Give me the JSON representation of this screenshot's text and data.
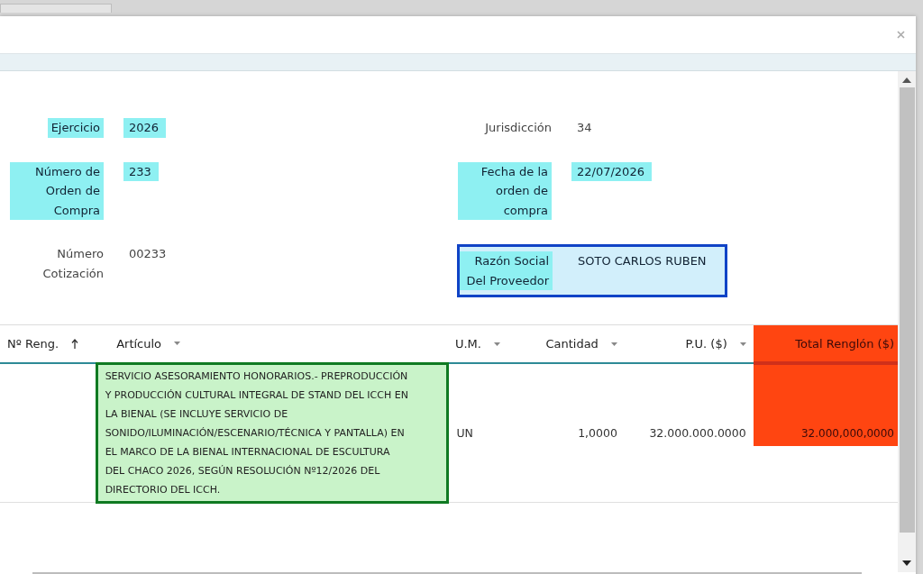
{
  "fields": [
    {
      "label": "Ejercicio",
      "value": "2026",
      "highlighted": true,
      "framed": false
    },
    {
      "label": "Jurisdicción",
      "value": "34",
      "highlighted": false,
      "framed": false
    },
    {
      "label": "Número de Orden de Compra",
      "value": "233",
      "highlighted": true,
      "framed": false
    },
    {
      "label": "Fecha de la orden de compra",
      "value": "22/07/2026",
      "highlighted": true,
      "framed": false
    },
    {
      "label": "Número Cotización",
      "value": "00233",
      "highlighted": false,
      "framed": false
    },
    {
      "label": "Razón Social Del Proveedor",
      "value": "SOTO CARLOS RUBEN",
      "highlighted": true,
      "framed": true
    }
  ],
  "table": {
    "columns": [
      {
        "label": "Nº Reng.",
        "sorted": true,
        "menu": false,
        "highlighted": false
      },
      {
        "label": "Artículo",
        "sorted": false,
        "menu": true,
        "highlighted": false
      },
      {
        "label": "U.M.",
        "sorted": false,
        "menu": true,
        "highlighted": false
      },
      {
        "label": "Cantidad",
        "sorted": false,
        "menu": true,
        "highlighted": false
      },
      {
        "label": "P.U. ($)",
        "sorted": false,
        "menu": true,
        "highlighted": false
      },
      {
        "label": "Total Renglón ($)",
        "sorted": false,
        "menu": false,
        "highlighted": true
      }
    ],
    "rows": [
      {
        "cells": [
          {
            "text": "",
            "framed": false
          },
          {
            "text": "SERVICIO ASESORAMIENTO HONORARIOS.- PREPRODUCCIÓN Y PRODUCCIÓN CULTURAL INTEGRAL DE STAND DEL ICCH EN LA BIENAL (SE INCLUYE SERVICIO DE SONIDO/ILUMINACIÓN/ESCENARIO/TÉCNICA Y PANTALLA) EN EL MARCO DE LA BIENAL INTERNACIONAL DE ESCULTURA DEL CHACO 2026, SEGÚN RESOLUCIÓN Nº12/2026 DEL DIRECTORIO DEL ICCH.",
            "framed": true
          },
          {
            "text": "UN",
            "framed": false
          },
          {
            "text": "1,0000",
            "framed": false
          },
          {
            "text": "32.000.000.0000",
            "framed": false
          },
          {
            "text": "32.000,000,0000",
            "framed": false
          }
        ]
      }
    ]
  }
}
